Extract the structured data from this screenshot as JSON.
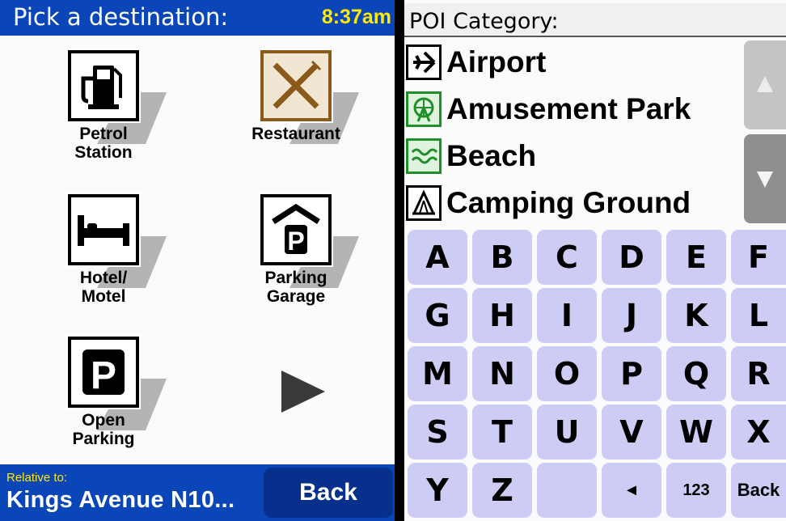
{
  "left": {
    "title": "Pick a destination:",
    "clock": "8:37am",
    "tiles": [
      {
        "label": "Petrol\nStation",
        "icon": "petrol-pump-icon"
      },
      {
        "label": "Restaurant",
        "icon": "fork-knife-icon"
      },
      {
        "label": "Hotel/\nMotel",
        "icon": "bed-icon"
      },
      {
        "label": "Parking\nGarage",
        "icon": "parking-garage-icon"
      },
      {
        "label": "Open\nParking",
        "icon": "parking-icon"
      }
    ],
    "next_icon": "right-arrow-icon",
    "footer": {
      "relative_label": "Relative to:",
      "relative_value": "Kings Avenue N10...",
      "back_label": "Back"
    }
  },
  "right": {
    "title": "POI Category:",
    "categories": [
      {
        "label": "Airport",
        "icon": "airplane-icon"
      },
      {
        "label": "Amusement Park",
        "icon": "ferris-wheel-icon"
      },
      {
        "label": "Beach",
        "icon": "waves-icon"
      },
      {
        "label": "Camping Ground",
        "icon": "tent-icon"
      }
    ],
    "scroll_up_icon": "up-arrow-icon",
    "scroll_down_icon": "down-arrow-icon",
    "keys": [
      [
        "A",
        "B",
        "C",
        "D",
        "E",
        "F"
      ],
      [
        "G",
        "H",
        "I",
        "J",
        "K",
        "L"
      ],
      [
        "M",
        "N",
        "O",
        "P",
        "Q",
        "R"
      ],
      [
        "S",
        "T",
        "U",
        "V",
        "W",
        "X"
      ],
      [
        "Y",
        "Z",
        "",
        "◄",
        "123",
        "Back"
      ]
    ]
  },
  "colors": {
    "header_blue": "#0a46b8",
    "button_blue": "#06308c",
    "clock_yellow": "#ffea00",
    "key_lavender": "#ccccf4"
  }
}
